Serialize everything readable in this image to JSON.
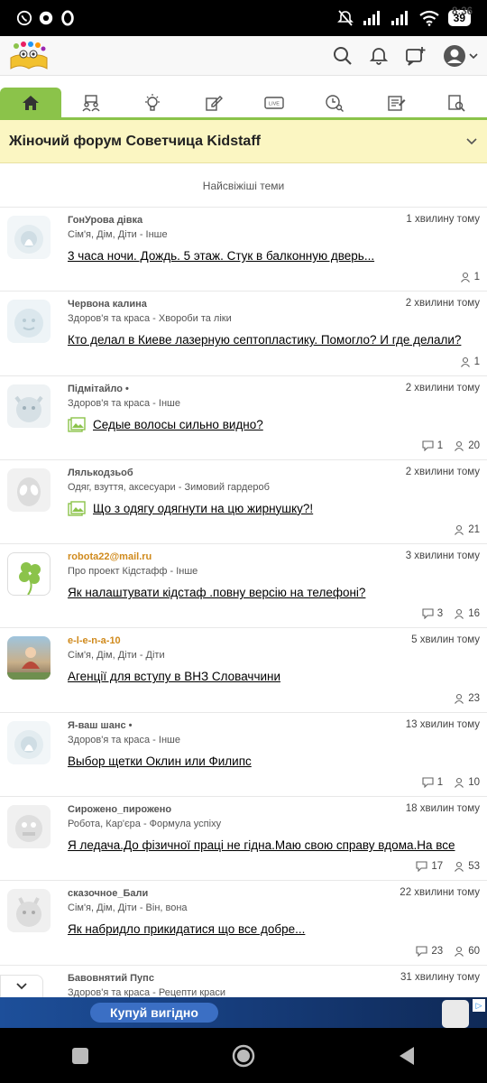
{
  "status": {
    "time": "8:36",
    "battery": "39"
  },
  "forum": {
    "title": "Жіночий форум Советчица Kidstaff"
  },
  "section": {
    "title": "Найсвіжіші теми"
  },
  "topics": [
    {
      "author": "ГонУрова дівка",
      "category": "Сім'я, Дім, Діти - Інше",
      "time": "1 хвилину тому",
      "title": "3 часа ночи. Дождь. 5 этаж. Стук в балконную дверь...",
      "comments": "",
      "views": "1"
    },
    {
      "author": "Червона калина",
      "category": "Здоров'я та краса - Хвороби та ліки",
      "time": "2 хвилини тому",
      "title": "Кто делал в Киеве лазерную септопластику. Помогло? И где делали?",
      "comments": "",
      "views": "1"
    },
    {
      "author": "Підмітайло •",
      "category": "Здоров'я та краса - Інше",
      "time": "2 хвилини тому",
      "title": "Седые волосы сильно видно?",
      "comments": "1",
      "views": "20"
    },
    {
      "author": "Лялькодзьоб",
      "category": "Одяг, взуття, аксесуари - Зимовий гардероб",
      "time": "2 хвилини тому",
      "title": "Що з одягу одягнути на цю жирнушку?!",
      "comments": "",
      "views": "21"
    },
    {
      "author": "robota22@mail.ru",
      "category": "Про проект Кідстафф - Інше",
      "time": "3 хвилини тому",
      "title": "Як налаштувати кідстаф .повну версію на телефоні?",
      "comments": "3",
      "views": "16"
    },
    {
      "author": "e-l-e-n-a-10",
      "category": "Сім'я, Дім, Діти - Діти",
      "time": "5 хвилин тому",
      "title": "Агенції для вступу в ВНЗ Словаччини",
      "comments": "",
      "views": "23"
    },
    {
      "author": "Я-ваш шанс •",
      "category": "Здоров'я та краса - Інше",
      "time": "13 хвилин тому",
      "title": "Выбор щетки Оклин или Филипс",
      "comments": "1",
      "views": "10"
    },
    {
      "author": "Сирожено_пирожено",
      "category": "Робота, Кар'єра - Формула успіху",
      "time": "18 хвилин тому",
      "title": "Я ледача.До фізичної праці не гідна.Маю свою справу вдома.На все",
      "comments": "17",
      "views": "53"
    },
    {
      "author": "сказочное_Бали",
      "category": "Сім'я, Дім, Діти - Він, вона",
      "time": "22 хвилини тому",
      "title": "Як набридло прикидатися що все добре...",
      "comments": "23",
      "views": "60"
    },
    {
      "author": "Бавовнятий Пупс",
      "category": "Здоров'я та краса - Рецепти краси",
      "time": "31 хвилину тому",
      "title": "",
      "comments": "",
      "views": ""
    }
  ],
  "ad": {
    "button": "Купуй вигідно"
  },
  "colors": {
    "accent": "#8bc34a",
    "forum_bg": "#fbf6c2",
    "link_orange": "#d08a1c"
  }
}
